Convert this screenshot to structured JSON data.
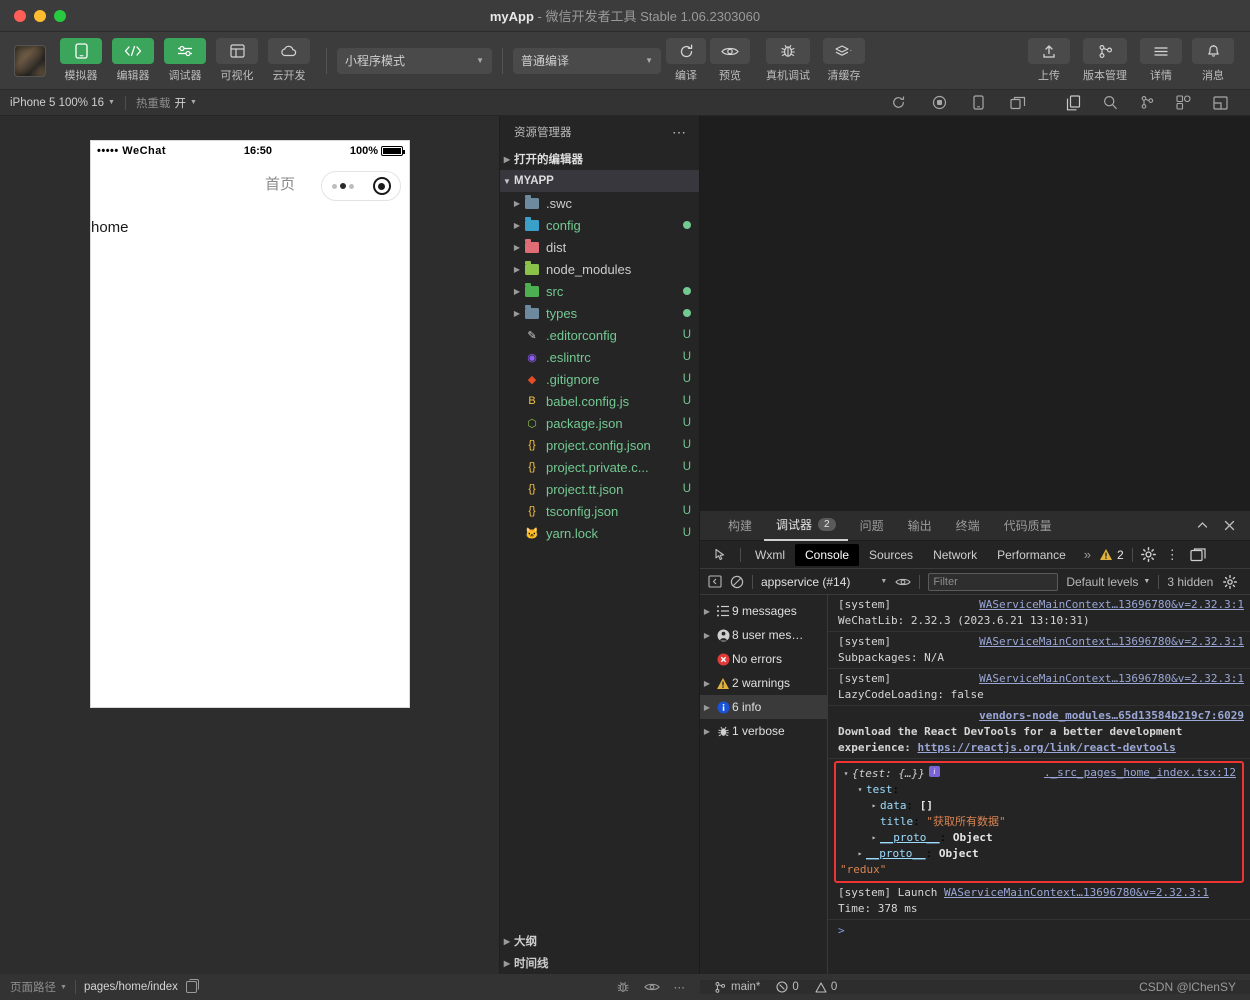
{
  "window": {
    "title_app": "myApp",
    "title_rest": " - 微信开发者工具 Stable 1.06.2303060"
  },
  "toolbar": {
    "buttons": [
      {
        "label": "模拟器",
        "icon": "simulator-icon",
        "active": true
      },
      {
        "label": "编辑器",
        "icon": "code-icon",
        "active": true
      },
      {
        "label": "调试器",
        "icon": "debugger-icon",
        "active": true
      },
      {
        "label": "可视化",
        "icon": "layout-icon",
        "active": false
      },
      {
        "label": "云开发",
        "icon": "cloud-icon",
        "active": false
      }
    ],
    "mode_select": "小程序模式",
    "compile_select": "普通编译",
    "actions": [
      {
        "label": "编译",
        "icon": "refresh-icon"
      },
      {
        "label": "预览",
        "icon": "eye-icon"
      },
      {
        "label": "真机调试",
        "icon": "bug-icon"
      },
      {
        "label": "清缓存",
        "icon": "layers-icon"
      }
    ],
    "right_actions": [
      {
        "label": "上传",
        "icon": "upload-icon"
      },
      {
        "label": "版本管理",
        "icon": "branch-icon"
      },
      {
        "label": "详情",
        "icon": "menu-icon"
      },
      {
        "label": "消息",
        "icon": "bell-icon"
      }
    ]
  },
  "subbar": {
    "device": "iPhone 5 100% 16",
    "hot_reload_label": "热重载",
    "hot_reload_value": "开",
    "sim_icons": [
      "refresh-icon",
      "record-icon",
      "device-icon",
      "window-icon"
    ],
    "activity_icons": [
      "files-icon",
      "search-icon",
      "source-control-icon",
      "extensions-icon",
      "layout-icon",
      "docker-icon"
    ]
  },
  "simulator": {
    "status": {
      "carrier": "••••• WeChat",
      "time": "16:50",
      "battery": "100%"
    },
    "nav_title": "首页",
    "page_text": "home"
  },
  "explorer": {
    "header": "资源管理器",
    "more": "⋯",
    "open_editors": "打开的编辑器",
    "root": "MYAPP",
    "items": [
      {
        "name": ".swc",
        "type": "folder",
        "color": "#6d8a9e",
        "status": "",
        "dot": false,
        "green": false
      },
      {
        "name": "config",
        "type": "folder",
        "color": "#3aa0c9",
        "status": "",
        "dot": true,
        "green": true
      },
      {
        "name": "dist",
        "type": "folder",
        "color": "#e06c75",
        "status": "",
        "dot": false,
        "green": false
      },
      {
        "name": "node_modules",
        "type": "folder",
        "color": "#8bc34a",
        "status": "",
        "dot": false,
        "green": false
      },
      {
        "name": "src",
        "type": "folder",
        "color": "#4caf50",
        "status": "",
        "dot": true,
        "green": true
      },
      {
        "name": "types",
        "type": "folder",
        "color": "#6d8a9e",
        "status": "",
        "dot": true,
        "green": true
      },
      {
        "name": ".editorconfig",
        "type": "file",
        "color": "#cfcfcf",
        "status": "U",
        "dot": false,
        "green": true,
        "glyph": "✎"
      },
      {
        "name": ".eslintrc",
        "type": "file",
        "color": "#8b5cf6",
        "status": "U",
        "dot": false,
        "green": true,
        "glyph": "◉"
      },
      {
        "name": ".gitignore",
        "type": "file",
        "color": "#e44d26",
        "status": "U",
        "dot": false,
        "green": true,
        "glyph": "◆"
      },
      {
        "name": "babel.config.js",
        "type": "file",
        "color": "#f5c542",
        "status": "U",
        "dot": false,
        "green": true,
        "glyph": "B"
      },
      {
        "name": "package.json",
        "type": "file",
        "color": "#8bc34a",
        "status": "U",
        "dot": false,
        "green": true,
        "glyph": "⬡"
      },
      {
        "name": "project.config.json",
        "type": "file",
        "color": "#f5c542",
        "status": "U",
        "dot": false,
        "green": true,
        "glyph": "{}"
      },
      {
        "name": "project.private.c...",
        "type": "file",
        "color": "#f5c542",
        "status": "U",
        "dot": false,
        "green": true,
        "glyph": "{}"
      },
      {
        "name": "project.tt.json",
        "type": "file",
        "color": "#f5c542",
        "status": "U",
        "dot": false,
        "green": true,
        "glyph": "{}"
      },
      {
        "name": "tsconfig.json",
        "type": "file",
        "color": "#f5c542",
        "status": "U",
        "dot": false,
        "green": true,
        "glyph": "{}"
      },
      {
        "name": "yarn.lock",
        "type": "file",
        "color": "#4fa3d1",
        "status": "U",
        "dot": false,
        "green": true,
        "glyph": "🐱"
      }
    ],
    "footer": [
      "大纲",
      "时间线"
    ]
  },
  "devtools": {
    "panel_tabs": [
      {
        "label": "构建",
        "badge": "",
        "active": false
      },
      {
        "label": "调试器",
        "badge": "2",
        "active": true
      },
      {
        "label": "问题",
        "badge": "",
        "active": false
      },
      {
        "label": "输出",
        "badge": "",
        "active": false
      },
      {
        "label": "终端",
        "badge": "",
        "active": false
      },
      {
        "label": "代码质量",
        "badge": "",
        "active": false
      }
    ],
    "panel_controls": [
      "collapse-icon",
      "close-icon"
    ],
    "devtool_tabs": [
      {
        "label": "Wxml",
        "selected": false
      },
      {
        "label": "Console",
        "selected": true
      },
      {
        "label": "Sources",
        "selected": false
      },
      {
        "label": "Network",
        "selected": false
      },
      {
        "label": "Performance",
        "selected": false
      }
    ],
    "overflow": "»",
    "warning_count": "2",
    "filter_bar": {
      "context": "appservice (#14)",
      "filter_placeholder": "Filter",
      "levels": "Default levels",
      "hidden": "3 hidden"
    },
    "message_summary": [
      {
        "label": "9 messages",
        "icon": "list-icon",
        "expandable": true,
        "selected": false
      },
      {
        "label": "8 user mes…",
        "icon": "user-icon",
        "expandable": true,
        "selected": false
      },
      {
        "label": "No errors",
        "icon": "error-icon",
        "expandable": false,
        "selected": false
      },
      {
        "label": "2 warnings",
        "icon": "warning-icon",
        "expandable": true,
        "selected": false
      },
      {
        "label": "6 info",
        "icon": "info-icon",
        "expandable": true,
        "selected": true
      },
      {
        "label": "1 verbose",
        "icon": "verbose-icon",
        "expandable": true,
        "selected": false
      }
    ],
    "logs": [
      {
        "tag": "[system]",
        "source": "WAServiceMainContext…13696780&v=2.32.3:1",
        "body": "WeChatLib: 2.32.3 (2023.6.21 13:10:31)",
        "bold": false
      },
      {
        "tag": "[system]",
        "source": "WAServiceMainContext…13696780&v=2.32.3:1",
        "body": "Subpackages: N/A",
        "bold": false
      },
      {
        "tag": "[system]",
        "source": "WAServiceMainContext…13696780&v=2.32.3:1",
        "body": "LazyCodeLoading: false",
        "bold": false
      },
      {
        "tag": "",
        "source": "vendors-node_modules…65d13584b219c7:6029",
        "body": "Download the React DevTools for a better development experience: ",
        "body_link": "https://reactjs.org/link/react-devtools",
        "bold": true
      }
    ],
    "highlighted_object": {
      "source": "._src_pages_home_index.tsx:12",
      "summary": "{test: {…}}",
      "info_badge": "i",
      "lines": [
        {
          "indent": 1,
          "triangle": "▾",
          "key": "test",
          "sep": ":",
          "value": "",
          "value_kind": "none"
        },
        {
          "indent": 2,
          "triangle": "▸",
          "key": "data",
          "sep": ":",
          "value": "[]",
          "value_kind": "plain"
        },
        {
          "indent": 2,
          "triangle": "",
          "key": "title",
          "sep": ":",
          "value": "\"获取所有数据\"",
          "value_kind": "string"
        },
        {
          "indent": 2,
          "triangle": "▸",
          "key": "__proto__",
          "sep": ":",
          "value": "Object",
          "value_kind": "object"
        },
        {
          "indent": 1,
          "triangle": "▸",
          "key": "__proto__",
          "sep": ":",
          "value": "Object",
          "value_kind": "object"
        }
      ],
      "trailing": "\"redux\""
    },
    "launch_log": {
      "tag": "[system] Launch",
      "source": "WAServiceMainContext…13696780&v=2.32.3:1",
      "body": "Time: 378 ms"
    },
    "prompt": ">"
  },
  "statusbar": {
    "page_path_label": "页面路径",
    "page_path": "pages/home/index",
    "copy_icon": "copy-icon",
    "icons": [
      "bug-icon",
      "eye-icon",
      "more-icon"
    ],
    "branch": "main*",
    "errors": "0",
    "warnings": "0",
    "watermark": "CSDN @lChenSY"
  },
  "colors": {
    "accent_green": "#3ba55c",
    "file_green": "#73c991",
    "warning_yellow": "#e2b33c",
    "error_red": "#f03434",
    "link_blue": "#9aa7d6"
  }
}
